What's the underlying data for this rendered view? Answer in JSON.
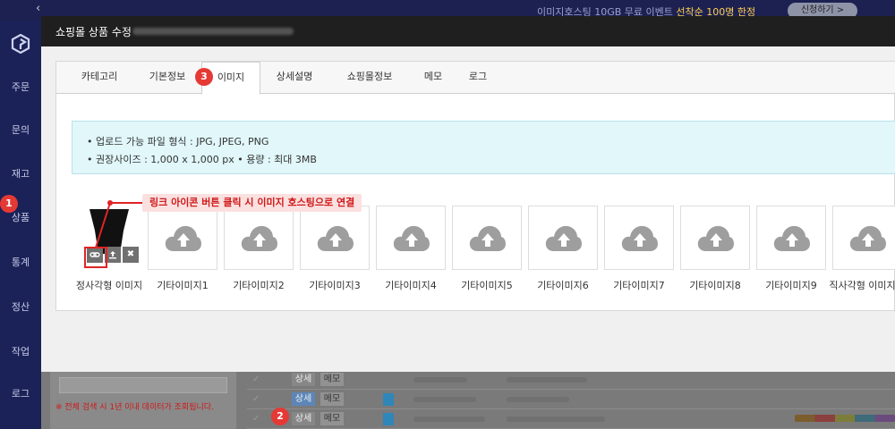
{
  "topbar": {
    "promo_text": "이미지호스팅 10GB 무료 이벤트",
    "promo_highlight": "선착순 100명 한정",
    "apply_label": "신청하기 >",
    "back_icon": "chevron-left-icon"
  },
  "sidebar": {
    "items": [
      {
        "label": "주문"
      },
      {
        "label": "문의"
      },
      {
        "label": "재고"
      },
      {
        "label": "상품"
      },
      {
        "label": "통계"
      },
      {
        "label": "정산"
      },
      {
        "label": "작업"
      },
      {
        "label": "로그"
      }
    ]
  },
  "background_list": {
    "warning": "※ 전체 검색 시 1년 이내 데이터가 조회됩니다.",
    "rows": [
      {
        "detail": "상세",
        "memo": "메모"
      },
      {
        "detail": "상세",
        "memo": "메모"
      },
      {
        "detail": "상세",
        "memo": "메모"
      }
    ]
  },
  "modal": {
    "title": "쇼핑몰 상품 수정",
    "tabs": [
      {
        "label": "카테고리"
      },
      {
        "label": "기본정보"
      },
      {
        "label": "이미지"
      },
      {
        "label": "상세설명"
      },
      {
        "label": "쇼핑몰정보"
      },
      {
        "label": "메모"
      },
      {
        "label": "로그"
      }
    ],
    "active_tab": "이미지",
    "info_lines": [
      "• 업로드 가능 파일 형식 : JPG, JPEG, PNG",
      "• 권장사이즈 : 1,000 x 1,000 px • 용량 : 최대 3MB"
    ],
    "tooltip": "링크 아이콘 버튼 클릭 시 이미지 호스팅으로 연결",
    "image_slots": [
      {
        "label": "정사각형 이미지"
      },
      {
        "label": "기타이미지1"
      },
      {
        "label": "기타이미지2"
      },
      {
        "label": "기타이미지3"
      },
      {
        "label": "기타이미지4"
      },
      {
        "label": "기타이미지5"
      },
      {
        "label": "기타이미지6"
      },
      {
        "label": "기타이미지7"
      },
      {
        "label": "기타이미지8"
      },
      {
        "label": "기타이미지9"
      },
      {
        "label": "직사각형 이미지"
      }
    ],
    "actions": {
      "link_icon": "link-icon",
      "upload_icon": "upload-icon",
      "delete_icon": "close-icon"
    }
  },
  "badges": [
    "1",
    "2",
    "3"
  ],
  "colors": {
    "sidebar_bg": "#1b2258",
    "badge_red": "#e53935",
    "info_bg": "#e1f7fa",
    "tooltip_bg": "#fbe0e0",
    "callout_red": "#e02424"
  }
}
